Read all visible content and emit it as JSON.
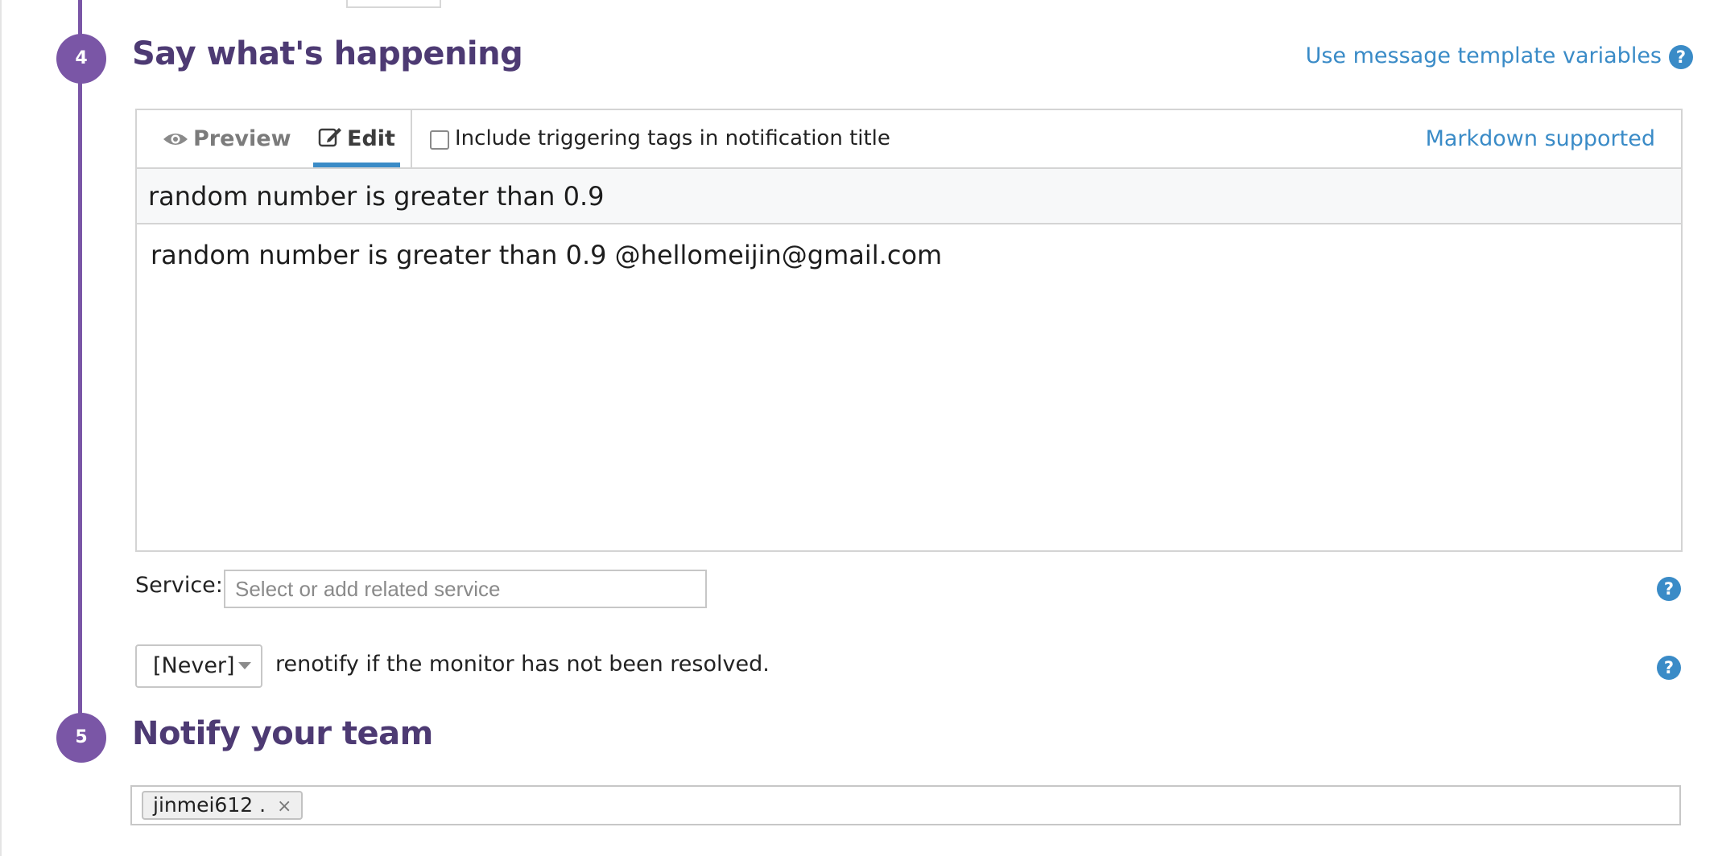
{
  "steps": {
    "say_whats_happening": {
      "number": "4",
      "title": "Say what's happening",
      "template_link": "Use message template variables",
      "help_glyph": "?",
      "tabs": {
        "preview": {
          "label": "Preview",
          "icon": "eye-icon"
        },
        "edit": {
          "label": "Edit",
          "icon": "edit-icon",
          "active": true
        }
      },
      "include_tags_label": "Include triggering tags in notification title",
      "include_tags_checked": false,
      "markdown_link": "Markdown supported",
      "title_value": "random number is greater than 0.9",
      "message_value": "random number is greater than 0.9 @hellomeijin@gmail.com",
      "service": {
        "label": "Service:",
        "placeholder": "Select or add related service"
      },
      "renotify": {
        "selected": "[Never]",
        "text": "renotify if the monitor has not been resolved."
      }
    },
    "notify_team": {
      "number": "5",
      "title": "Notify your team",
      "recipients": [
        {
          "label": "jinmei612 .",
          "remove_glyph": "×"
        }
      ]
    }
  },
  "colors": {
    "accent_purple": "#7a56a6",
    "title_purple": "#4d3a73",
    "link_blue": "#3a8bc7"
  }
}
